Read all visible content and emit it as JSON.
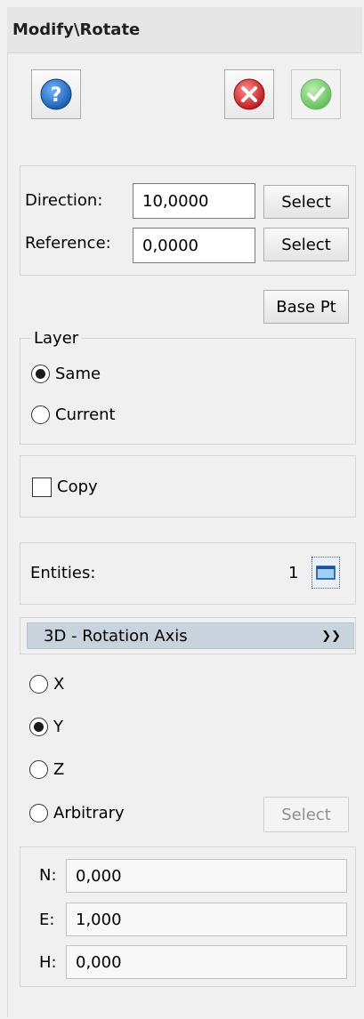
{
  "title": "Modify\\Rotate",
  "toolbar": {
    "help_icon": "question-icon",
    "cancel_icon": "close-icon",
    "ok_icon": "check-icon",
    "colors": {
      "help": "#1f6fc4",
      "cancel": "#d9262b",
      "ok": "#57c249"
    }
  },
  "direction": {
    "label": "Direction:",
    "value": "10,0000",
    "select_label": "Select"
  },
  "reference": {
    "label": "Reference:",
    "value": "0,0000",
    "select_label": "Select"
  },
  "base_pt_label": "Base Pt",
  "layer": {
    "legend": "Layer",
    "options": [
      {
        "label": "Same",
        "checked": true
      },
      {
        "label": "Current",
        "checked": false
      }
    ]
  },
  "copy": {
    "label": "Copy",
    "checked": false
  },
  "entities": {
    "label": "Entities:",
    "count": "1",
    "icon": "select-window-icon"
  },
  "rotation_axis": {
    "header": "3D - Rotation Axis",
    "collapse_icon": "double-chevron-down-icon",
    "options": [
      {
        "label": "X",
        "checked": false
      },
      {
        "label": "Y",
        "checked": true
      },
      {
        "label": "Z",
        "checked": false
      },
      {
        "label": "Arbitrary",
        "checked": false
      }
    ],
    "select_label": "Select"
  },
  "coords": {
    "n": {
      "label": "N:",
      "value": "0,000"
    },
    "e": {
      "label": "E:",
      "value": "1,000"
    },
    "h": {
      "label": "H:",
      "value": "0,000"
    }
  }
}
